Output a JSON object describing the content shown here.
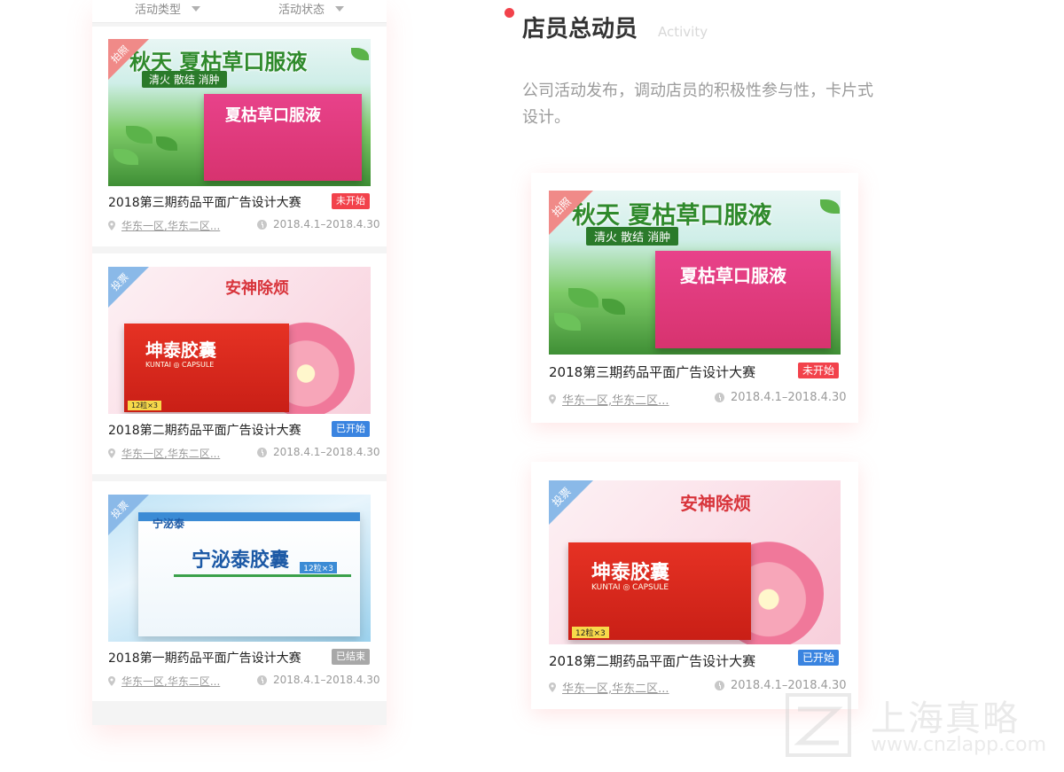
{
  "filters": {
    "type_label": "活动类型",
    "status_label": "活动状态"
  },
  "section": {
    "title": "店员总动员",
    "subtitle": "Activity",
    "description": "公司活动发布，调动店员的积极性参与性，卡片式设计。"
  },
  "posters": {
    "p1": {
      "corner": "拍照",
      "headline": "秋天 夏枯草口服液",
      "sub": "清火 散结 消肿",
      "box": "夏枯草口服液"
    },
    "p2": {
      "corner": "投票",
      "headline": "安神除烦",
      "box": "坤泰胶囊",
      "box_sub": "KUNTAI ◎ CAPSULE",
      "count": "12粒×3"
    },
    "p3": {
      "corner": "投票",
      "brand": "宁泌泰",
      "box": "宁泌泰胶囊",
      "count": "12粒×3"
    }
  },
  "cards": [
    {
      "title": "2018第三期药品平面广告设计大赛",
      "status": "未开始",
      "location": "华东一区,华东二区...",
      "date": "2018.4.1–2018.4.30"
    },
    {
      "title": "2018第二期药品平面广告设计大赛",
      "status": "已开始",
      "location": "华东一区,华东二区...",
      "date": "2018.4.1–2018.4.30"
    },
    {
      "title": "2018第一期药品平面广告设计大赛",
      "status": "已结束",
      "location": "华东一区,华东二区...",
      "date": "2018.4.1–2018.4.30"
    }
  ],
  "watermark": {
    "cn": "上海真略",
    "en": "www.cnzlapp.com"
  },
  "colors": {
    "accent_red": "#f2424b",
    "badge_blue": "#3a84e0",
    "badge_gray": "#a8a8a8"
  },
  "icons": [
    "caret-down-icon",
    "location-pin-icon",
    "clock-icon"
  ]
}
